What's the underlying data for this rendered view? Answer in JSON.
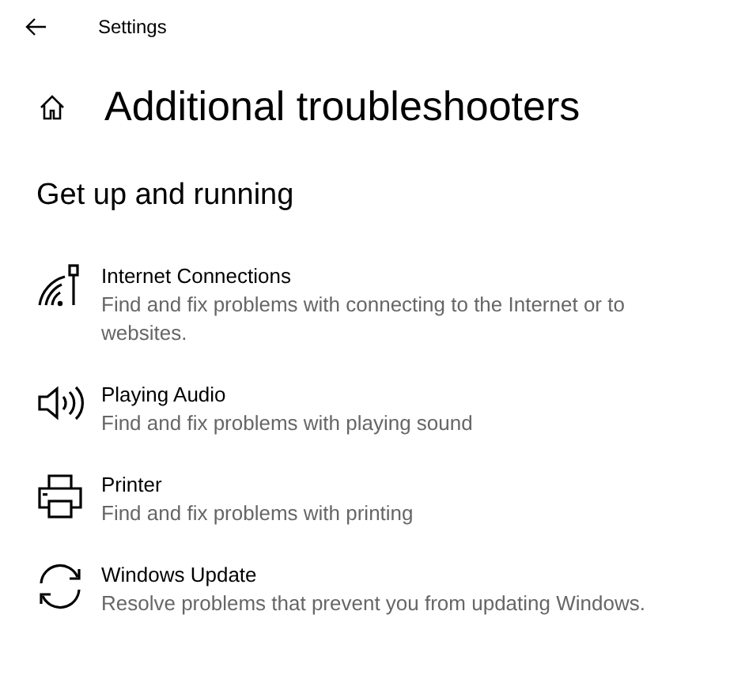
{
  "window": {
    "title": "Settings"
  },
  "page": {
    "title": "Additional troubleshooters"
  },
  "section": {
    "heading": "Get up and running"
  },
  "items": [
    {
      "kind": "network",
      "title": "Internet Connections",
      "description": "Find and fix problems with connecting to the Internet or to websites."
    },
    {
      "kind": "audio",
      "title": "Playing Audio",
      "description": "Find and fix problems with playing sound"
    },
    {
      "kind": "printer",
      "title": "Printer",
      "description": "Find and fix problems with printing"
    },
    {
      "kind": "update",
      "title": "Windows Update",
      "description": "Resolve problems that prevent you from updating Windows."
    }
  ]
}
